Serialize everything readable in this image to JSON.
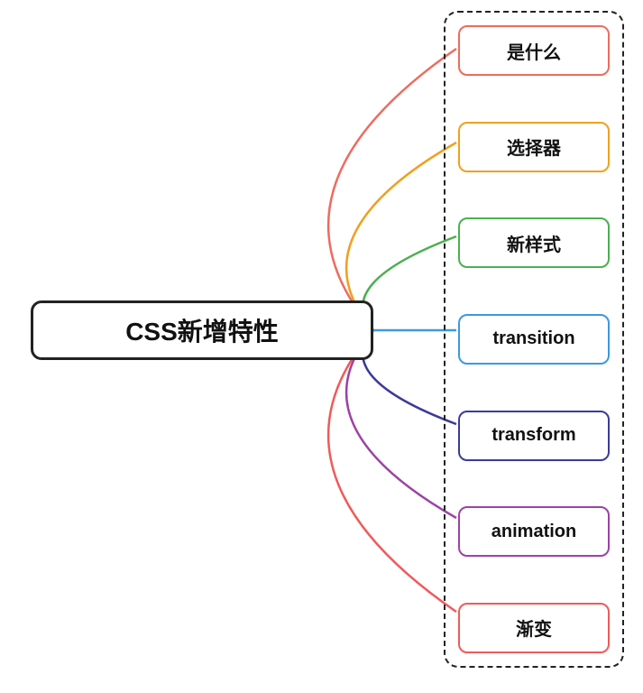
{
  "root": {
    "label": "CSS新增特性"
  },
  "children": [
    {
      "label": "是什么",
      "color": "#ee6b5f"
    },
    {
      "label": "选择器",
      "color": "#f0a020"
    },
    {
      "label": "新样式",
      "color": "#4caf50"
    },
    {
      "label": "transition",
      "color": "#3b99e0"
    },
    {
      "label": "transform",
      "color": "#3b3b9a"
    },
    {
      "label": "animation",
      "color": "#9c43a6"
    },
    {
      "label": "渐变",
      "color": "#f05a5a"
    }
  ],
  "layout": {
    "rootRightX": 414,
    "rootCenterY": 366,
    "childLeftX": 506,
    "childCenterYs": [
      54,
      158,
      262,
      366,
      470,
      574,
      678
    ]
  }
}
